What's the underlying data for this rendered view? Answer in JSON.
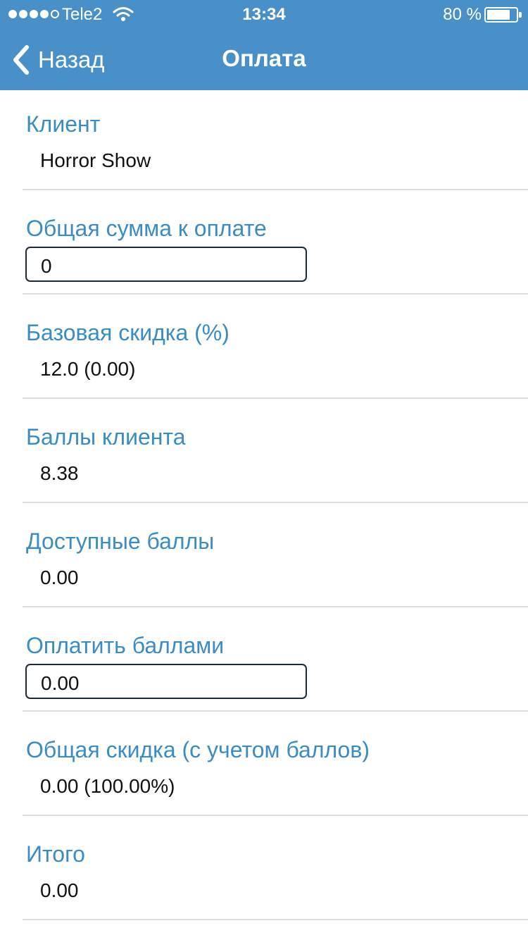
{
  "status_bar": {
    "carrier": "Tele2",
    "time": "13:34",
    "battery_percent": "80 %",
    "battery_level": 0.8,
    "signal_bars": 4,
    "signal_total": 5
  },
  "nav": {
    "back_label": "Назад",
    "title": "Оплата",
    "color": "#4a90c8"
  },
  "fields": {
    "client": {
      "label": "Клиент",
      "value": "Horror Show"
    },
    "total_to_pay": {
      "label": "Общая сумма к оплате",
      "value": "0"
    },
    "base_discount": {
      "label": "Базовая скидка (%)",
      "value": "12.0 (0.00)"
    },
    "client_points": {
      "label": "Баллы клиента",
      "value": "8.38"
    },
    "available_points": {
      "label": "Доступные баллы",
      "value": "0.00"
    },
    "pay_with_points": {
      "label": "Оплатить баллами",
      "value": "0.00"
    },
    "total_discount": {
      "label": "Общая скидка (с учетом баллов)",
      "value": "0.00 (100.00%)"
    },
    "total": {
      "label": "Итого",
      "value": "0.00"
    }
  },
  "colors": {
    "label": "#3a8cc4",
    "divider": "#dddddd"
  }
}
